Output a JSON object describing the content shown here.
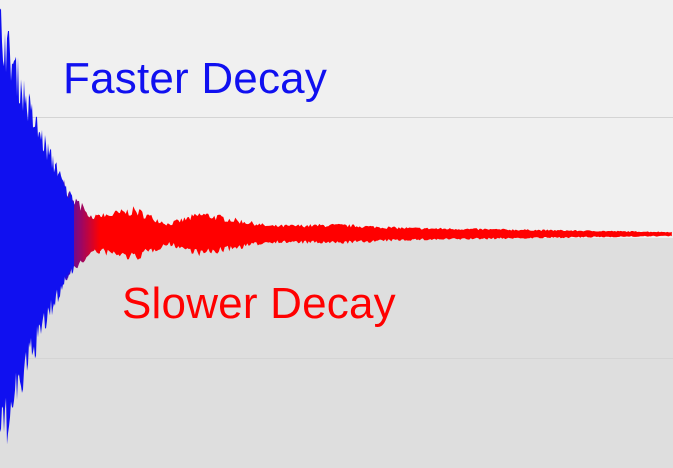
{
  "colors": {
    "fast_series": "#1010f0",
    "slow_series": "#ff0000",
    "background_upper": "#f0f0f0",
    "background_lower": "#dedede",
    "gridline": "#d4d4d4"
  },
  "annotations": {
    "fast_label": "Faster Decay",
    "slow_label": "Slower Decay"
  },
  "chart_data": {
    "type": "area",
    "title": "",
    "xlabel": "",
    "ylabel": "",
    "grid": true,
    "legend": "none",
    "annotations": [
      "Faster Decay",
      "Slower Decay"
    ],
    "series": [
      {
        "color": "#1010f0",
        "t": [
          0,
          0.05,
          0.1,
          0.15,
          0.2
        ],
        "amplitude": [
          1.0,
          0.55,
          0.2,
          0.05,
          0.02
        ]
      },
      {
        "color": "#ff0000",
        "t": [
          0.1,
          0.2,
          0.25,
          0.3,
          0.4,
          0.5,
          0.6,
          0.8,
          1.0
        ],
        "amplitude": [
          0.06,
          0.12,
          0.05,
          0.1,
          0.04,
          0.045,
          0.03,
          0.02,
          0.01
        ]
      }
    ]
  }
}
